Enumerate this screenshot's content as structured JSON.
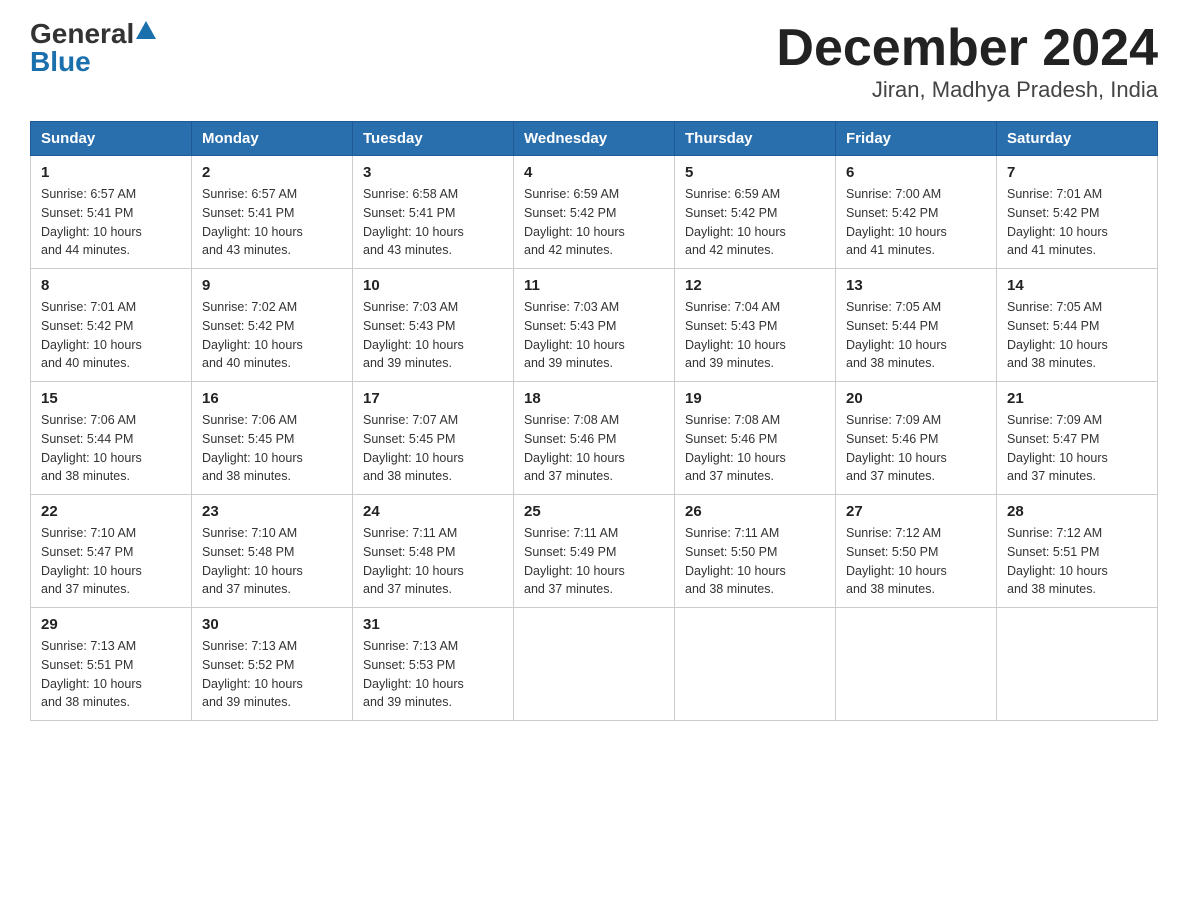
{
  "logo": {
    "general": "General",
    "blue": "Blue"
  },
  "title": "December 2024",
  "subtitle": "Jiran, Madhya Pradesh, India",
  "days_of_week": [
    "Sunday",
    "Monday",
    "Tuesday",
    "Wednesday",
    "Thursday",
    "Friday",
    "Saturday"
  ],
  "weeks": [
    [
      {
        "day": "1",
        "sunrise": "6:57 AM",
        "sunset": "5:41 PM",
        "daylight": "10 hours and 44 minutes."
      },
      {
        "day": "2",
        "sunrise": "6:57 AM",
        "sunset": "5:41 PM",
        "daylight": "10 hours and 43 minutes."
      },
      {
        "day": "3",
        "sunrise": "6:58 AM",
        "sunset": "5:41 PM",
        "daylight": "10 hours and 43 minutes."
      },
      {
        "day": "4",
        "sunrise": "6:59 AM",
        "sunset": "5:42 PM",
        "daylight": "10 hours and 42 minutes."
      },
      {
        "day": "5",
        "sunrise": "6:59 AM",
        "sunset": "5:42 PM",
        "daylight": "10 hours and 42 minutes."
      },
      {
        "day": "6",
        "sunrise": "7:00 AM",
        "sunset": "5:42 PM",
        "daylight": "10 hours and 41 minutes."
      },
      {
        "day": "7",
        "sunrise": "7:01 AM",
        "sunset": "5:42 PM",
        "daylight": "10 hours and 41 minutes."
      }
    ],
    [
      {
        "day": "8",
        "sunrise": "7:01 AM",
        "sunset": "5:42 PM",
        "daylight": "10 hours and 40 minutes."
      },
      {
        "day": "9",
        "sunrise": "7:02 AM",
        "sunset": "5:42 PM",
        "daylight": "10 hours and 40 minutes."
      },
      {
        "day": "10",
        "sunrise": "7:03 AM",
        "sunset": "5:43 PM",
        "daylight": "10 hours and 39 minutes."
      },
      {
        "day": "11",
        "sunrise": "7:03 AM",
        "sunset": "5:43 PM",
        "daylight": "10 hours and 39 minutes."
      },
      {
        "day": "12",
        "sunrise": "7:04 AM",
        "sunset": "5:43 PM",
        "daylight": "10 hours and 39 minutes."
      },
      {
        "day": "13",
        "sunrise": "7:05 AM",
        "sunset": "5:44 PM",
        "daylight": "10 hours and 38 minutes."
      },
      {
        "day": "14",
        "sunrise": "7:05 AM",
        "sunset": "5:44 PM",
        "daylight": "10 hours and 38 minutes."
      }
    ],
    [
      {
        "day": "15",
        "sunrise": "7:06 AM",
        "sunset": "5:44 PM",
        "daylight": "10 hours and 38 minutes."
      },
      {
        "day": "16",
        "sunrise": "7:06 AM",
        "sunset": "5:45 PM",
        "daylight": "10 hours and 38 minutes."
      },
      {
        "day": "17",
        "sunrise": "7:07 AM",
        "sunset": "5:45 PM",
        "daylight": "10 hours and 38 minutes."
      },
      {
        "day": "18",
        "sunrise": "7:08 AM",
        "sunset": "5:46 PM",
        "daylight": "10 hours and 37 minutes."
      },
      {
        "day": "19",
        "sunrise": "7:08 AM",
        "sunset": "5:46 PM",
        "daylight": "10 hours and 37 minutes."
      },
      {
        "day": "20",
        "sunrise": "7:09 AM",
        "sunset": "5:46 PM",
        "daylight": "10 hours and 37 minutes."
      },
      {
        "day": "21",
        "sunrise": "7:09 AM",
        "sunset": "5:47 PM",
        "daylight": "10 hours and 37 minutes."
      }
    ],
    [
      {
        "day": "22",
        "sunrise": "7:10 AM",
        "sunset": "5:47 PM",
        "daylight": "10 hours and 37 minutes."
      },
      {
        "day": "23",
        "sunrise": "7:10 AM",
        "sunset": "5:48 PM",
        "daylight": "10 hours and 37 minutes."
      },
      {
        "day": "24",
        "sunrise": "7:11 AM",
        "sunset": "5:48 PM",
        "daylight": "10 hours and 37 minutes."
      },
      {
        "day": "25",
        "sunrise": "7:11 AM",
        "sunset": "5:49 PM",
        "daylight": "10 hours and 37 minutes."
      },
      {
        "day": "26",
        "sunrise": "7:11 AM",
        "sunset": "5:50 PM",
        "daylight": "10 hours and 38 minutes."
      },
      {
        "day": "27",
        "sunrise": "7:12 AM",
        "sunset": "5:50 PM",
        "daylight": "10 hours and 38 minutes."
      },
      {
        "day": "28",
        "sunrise": "7:12 AM",
        "sunset": "5:51 PM",
        "daylight": "10 hours and 38 minutes."
      }
    ],
    [
      {
        "day": "29",
        "sunrise": "7:13 AM",
        "sunset": "5:51 PM",
        "daylight": "10 hours and 38 minutes."
      },
      {
        "day": "30",
        "sunrise": "7:13 AM",
        "sunset": "5:52 PM",
        "daylight": "10 hours and 39 minutes."
      },
      {
        "day": "31",
        "sunrise": "7:13 AM",
        "sunset": "5:53 PM",
        "daylight": "10 hours and 39 minutes."
      },
      null,
      null,
      null,
      null
    ]
  ],
  "labels": {
    "sunrise": "Sunrise:",
    "sunset": "Sunset:",
    "daylight": "Daylight:"
  }
}
